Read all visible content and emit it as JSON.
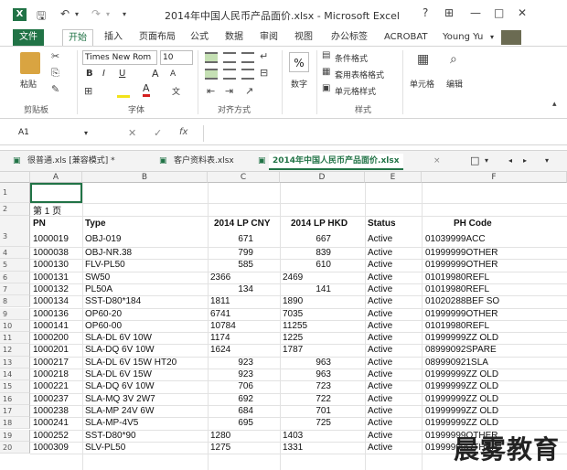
{
  "titlebar": {
    "title": "2014年中国人民币产品面价.xlsx - Microsoft Excel",
    "help": "?",
    "min": "—",
    "max": "□",
    "close": "✕"
  },
  "tabs": [
    "文件",
    "开始",
    "插入",
    "页面布局",
    "公式",
    "数据",
    "审阅",
    "视图",
    "办公标签",
    "ACROBAT"
  ],
  "user": "Young Yu",
  "ribbon": {
    "paste": "粘贴",
    "clipboard": "剪贴板",
    "font_name": "Times New Rom",
    "font_size": "10",
    "bold": "B",
    "italic": "I",
    "underline": "U",
    "grow": "A",
    "shrink": "A",
    "font_group": "字体",
    "align_group": "对齐方式",
    "number_pct": "%",
    "number_label": "数字",
    "cond_format": "条件格式",
    "table_format": "套用表格格式",
    "cell_style": "单元格样式",
    "style_group": "样式",
    "cells": "单元格",
    "edit": "编辑"
  },
  "formula_bar": {
    "name_box": "A1",
    "fx": "fx",
    "cancel": "✕",
    "enter": "✓"
  },
  "sheet_tabs": [
    {
      "label": "很普通.xls [兼容模式] *"
    },
    {
      "label": "客户资料表.xlsx"
    },
    {
      "label": "2014年中国人民币产品面价.xlsx"
    }
  ],
  "sheet_tab_close": "×",
  "columns": [
    "A",
    "B",
    "C",
    "D",
    "E",
    "F"
  ],
  "page_label": "第  1 页",
  "headers": {
    "pn": "PN",
    "type": "Type",
    "cny": "2014 LP CNY",
    "hkd": "2014 LP HKD",
    "status": "Status",
    "ph": "PH Code"
  },
  "rows": [
    {
      "n": "3",
      "pn": "1000019",
      "type": "OBJ-019",
      "cny": "671",
      "hkd": "667",
      "status": "Active",
      "ph": "01039999ACC"
    },
    {
      "n": "4",
      "pn": "1000038",
      "type": "OBJ-NR.38",
      "cny": "799",
      "hkd": "839",
      "status": "Active",
      "ph": "01999999OTHER"
    },
    {
      "n": "5",
      "pn": "1000130",
      "type": "FLV-PL50",
      "cny": "585",
      "hkd": "610",
      "status": "Active",
      "ph": "01999999OTHER"
    },
    {
      "n": "6",
      "pn": "1000131",
      "type": "SW50",
      "cny": "2366",
      "hkd": "2469",
      "status": "Active",
      "ph": "01019980REFL"
    },
    {
      "n": "7",
      "pn": "1000132",
      "type": "PL50A",
      "cny": "134",
      "hkd": "141",
      "status": "Active",
      "ph": "01019980REFL"
    },
    {
      "n": "8",
      "pn": "1000134",
      "type": "SST-D80*184",
      "cny": "1811",
      "hkd": "1890",
      "status": "Active",
      "ph": "01020288BEF  SO"
    },
    {
      "n": "9",
      "pn": "1000136",
      "type": "OP60-20",
      "cny": "6741",
      "hkd": "7035",
      "status": "Active",
      "ph": "01999999OTHER"
    },
    {
      "n": "10",
      "pn": "1000141",
      "type": "OP60-00",
      "cny": "10784",
      "hkd": "11255",
      "status": "Active",
      "ph": "01019980REFL"
    },
    {
      "n": "11",
      "pn": "1000200",
      "type": "SLA-DL 6V 10W",
      "cny": "1174",
      "hkd": "1225",
      "status": "Active",
      "ph": "01999999ZZ  OLD"
    },
    {
      "n": "12",
      "pn": "1000201",
      "type": "SLA-DQ 6V 10W",
      "cny": "1624",
      "hkd": "1787",
      "status": "Active",
      "ph": "08999092SPARE"
    },
    {
      "n": "13",
      "pn": "1000217",
      "type": "SLA-DL 6V 15W HT20",
      "cny": "923",
      "hkd": "963",
      "status": "Active",
      "ph": "089990921SLA"
    },
    {
      "n": "14",
      "pn": "1000218",
      "type": "SLA-DL 6V 15W",
      "cny": "923",
      "hkd": "963",
      "status": "Active",
      "ph": "01999999ZZ  OLD"
    },
    {
      "n": "15",
      "pn": "1000221",
      "type": "SLA-DQ 6V 10W",
      "cny": "706",
      "hkd": "723",
      "status": "Active",
      "ph": "01999999ZZ  OLD"
    },
    {
      "n": "16",
      "pn": "1000237",
      "type": "SLA-MQ 3V 2W7",
      "cny": "692",
      "hkd": "722",
      "status": "Active",
      "ph": "01999999ZZ  OLD"
    },
    {
      "n": "17",
      "pn": "1000238",
      "type": "SLA-MP 24V 6W",
      "cny": "684",
      "hkd": "701",
      "status": "Active",
      "ph": "01999999ZZ  OLD"
    },
    {
      "n": "18",
      "pn": "1000241",
      "type": "SLA-MP-4V5",
      "cny": "695",
      "hkd": "725",
      "status": "Active",
      "ph": "01999999ZZ  OLD"
    },
    {
      "n": "19",
      "pn": "1000252",
      "type": "SST-D80*90",
      "cny": "1280",
      "hkd": "1403",
      "status": "Active",
      "ph": "01999999OTHER"
    },
    {
      "n": "20",
      "pn": "1000309",
      "type": "SLV-PL50",
      "cny": "1275",
      "hkd": "1331",
      "status": "Active",
      "ph": "01999999OTHER"
    }
  ],
  "watermark": "晨雾教育"
}
